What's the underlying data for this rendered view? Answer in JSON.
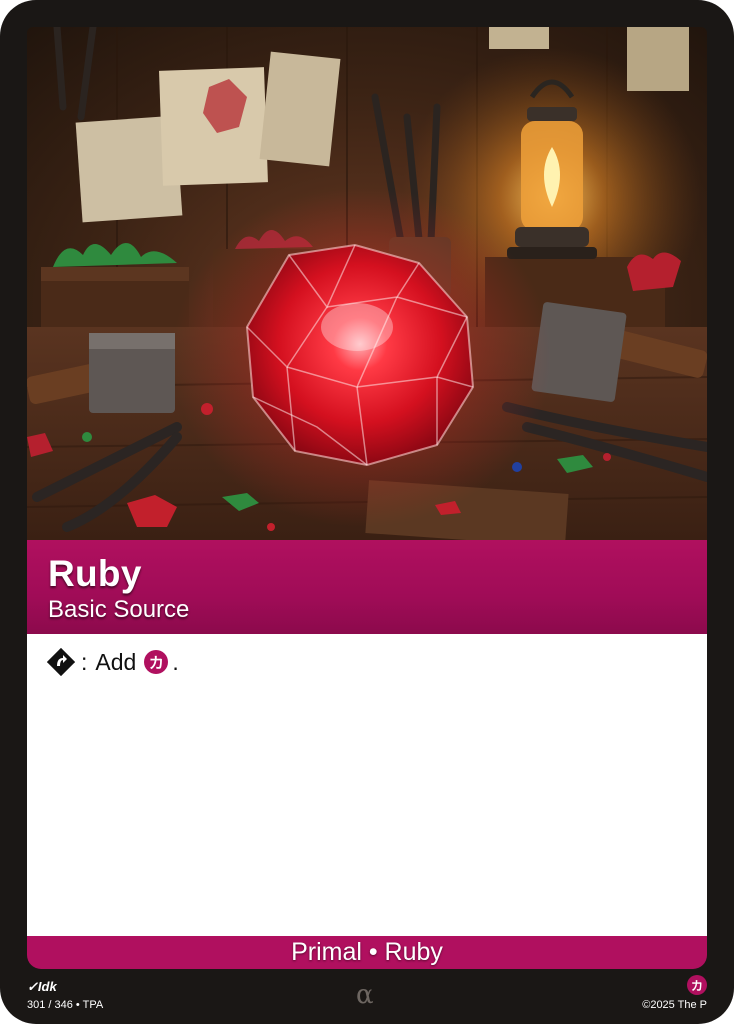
{
  "card": {
    "name": "Ruby",
    "type": "Basic Source",
    "rules": {
      "tap_icon": "tap-diamond-icon",
      "colon": ":",
      "add_word": "Add",
      "mana_symbol": "カ",
      "period": "."
    },
    "type_line": "Primal • Ruby",
    "artist_credit": "✓Idk",
    "set_info": "301 / 346 • TPA",
    "rarity_symbol": "α",
    "footer_mana_symbol": "カ",
    "copyright": "©2025 The P"
  },
  "art": {
    "subject": "ruby-gem-icon",
    "description_icons": [
      "lantern-icon",
      "hammer-icon",
      "pliers-icon",
      "gem-icon"
    ]
  },
  "colors": {
    "accent": "#b0105f",
    "frame": "#1a1715",
    "ruby": "#e0162a"
  }
}
